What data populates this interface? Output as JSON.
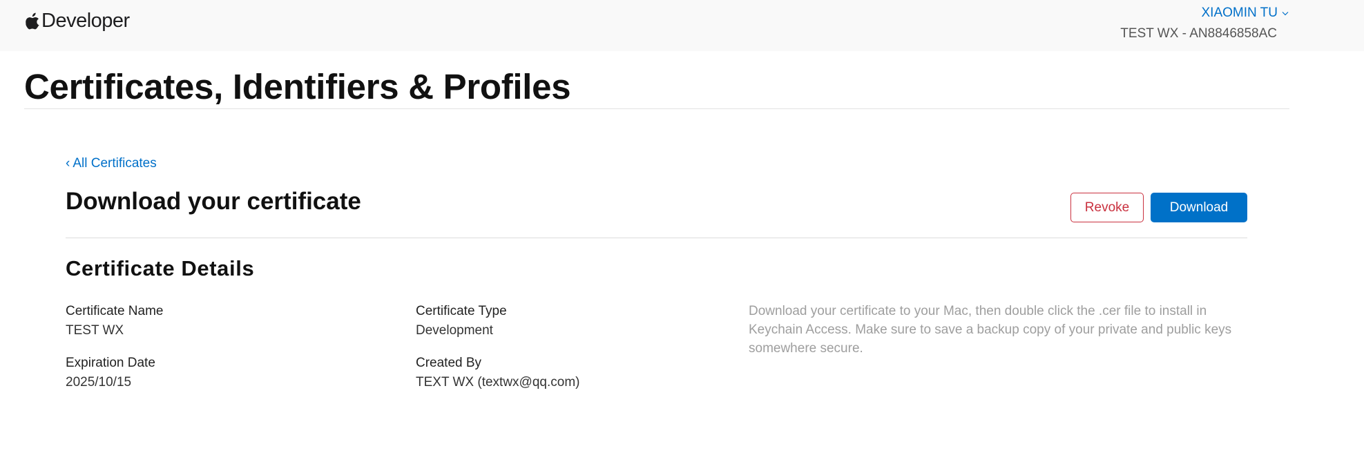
{
  "header": {
    "brand": "Developer",
    "user_name": "XIAOMIN TU",
    "team": "TEST WX - AN8846858AC"
  },
  "page": {
    "title": "Certificates, Identifiers & Profiles"
  },
  "certificate": {
    "back_link": "All Certificates",
    "heading": "Download your certificate",
    "revoke_label": "Revoke",
    "download_label": "Download",
    "details_heading": "Certificate Details",
    "name_label": "Certificate Name",
    "name_value": "TEST WX",
    "expiration_label": "Expiration Date",
    "expiration_value": "2025/10/15",
    "type_label": "Certificate Type",
    "type_value": "Development",
    "created_by_label": "Created By",
    "created_by_value": "TEXT WX (textwx@qq.com)",
    "help_text": "Download your certificate to your Mac, then double click the .cer file to install in Keychain Access. Make sure to save a backup copy of your private and public keys somewhere secure."
  },
  "colors": {
    "accent": "#0070c9",
    "danger": "#c9303e",
    "primary_button": "#0071c8",
    "topbar_bg": "#f9f9f9",
    "muted_text": "#9e9e9e"
  },
  "icons": [
    "apple-icon",
    "chevron-down-icon",
    "chevron-left-icon"
  ]
}
